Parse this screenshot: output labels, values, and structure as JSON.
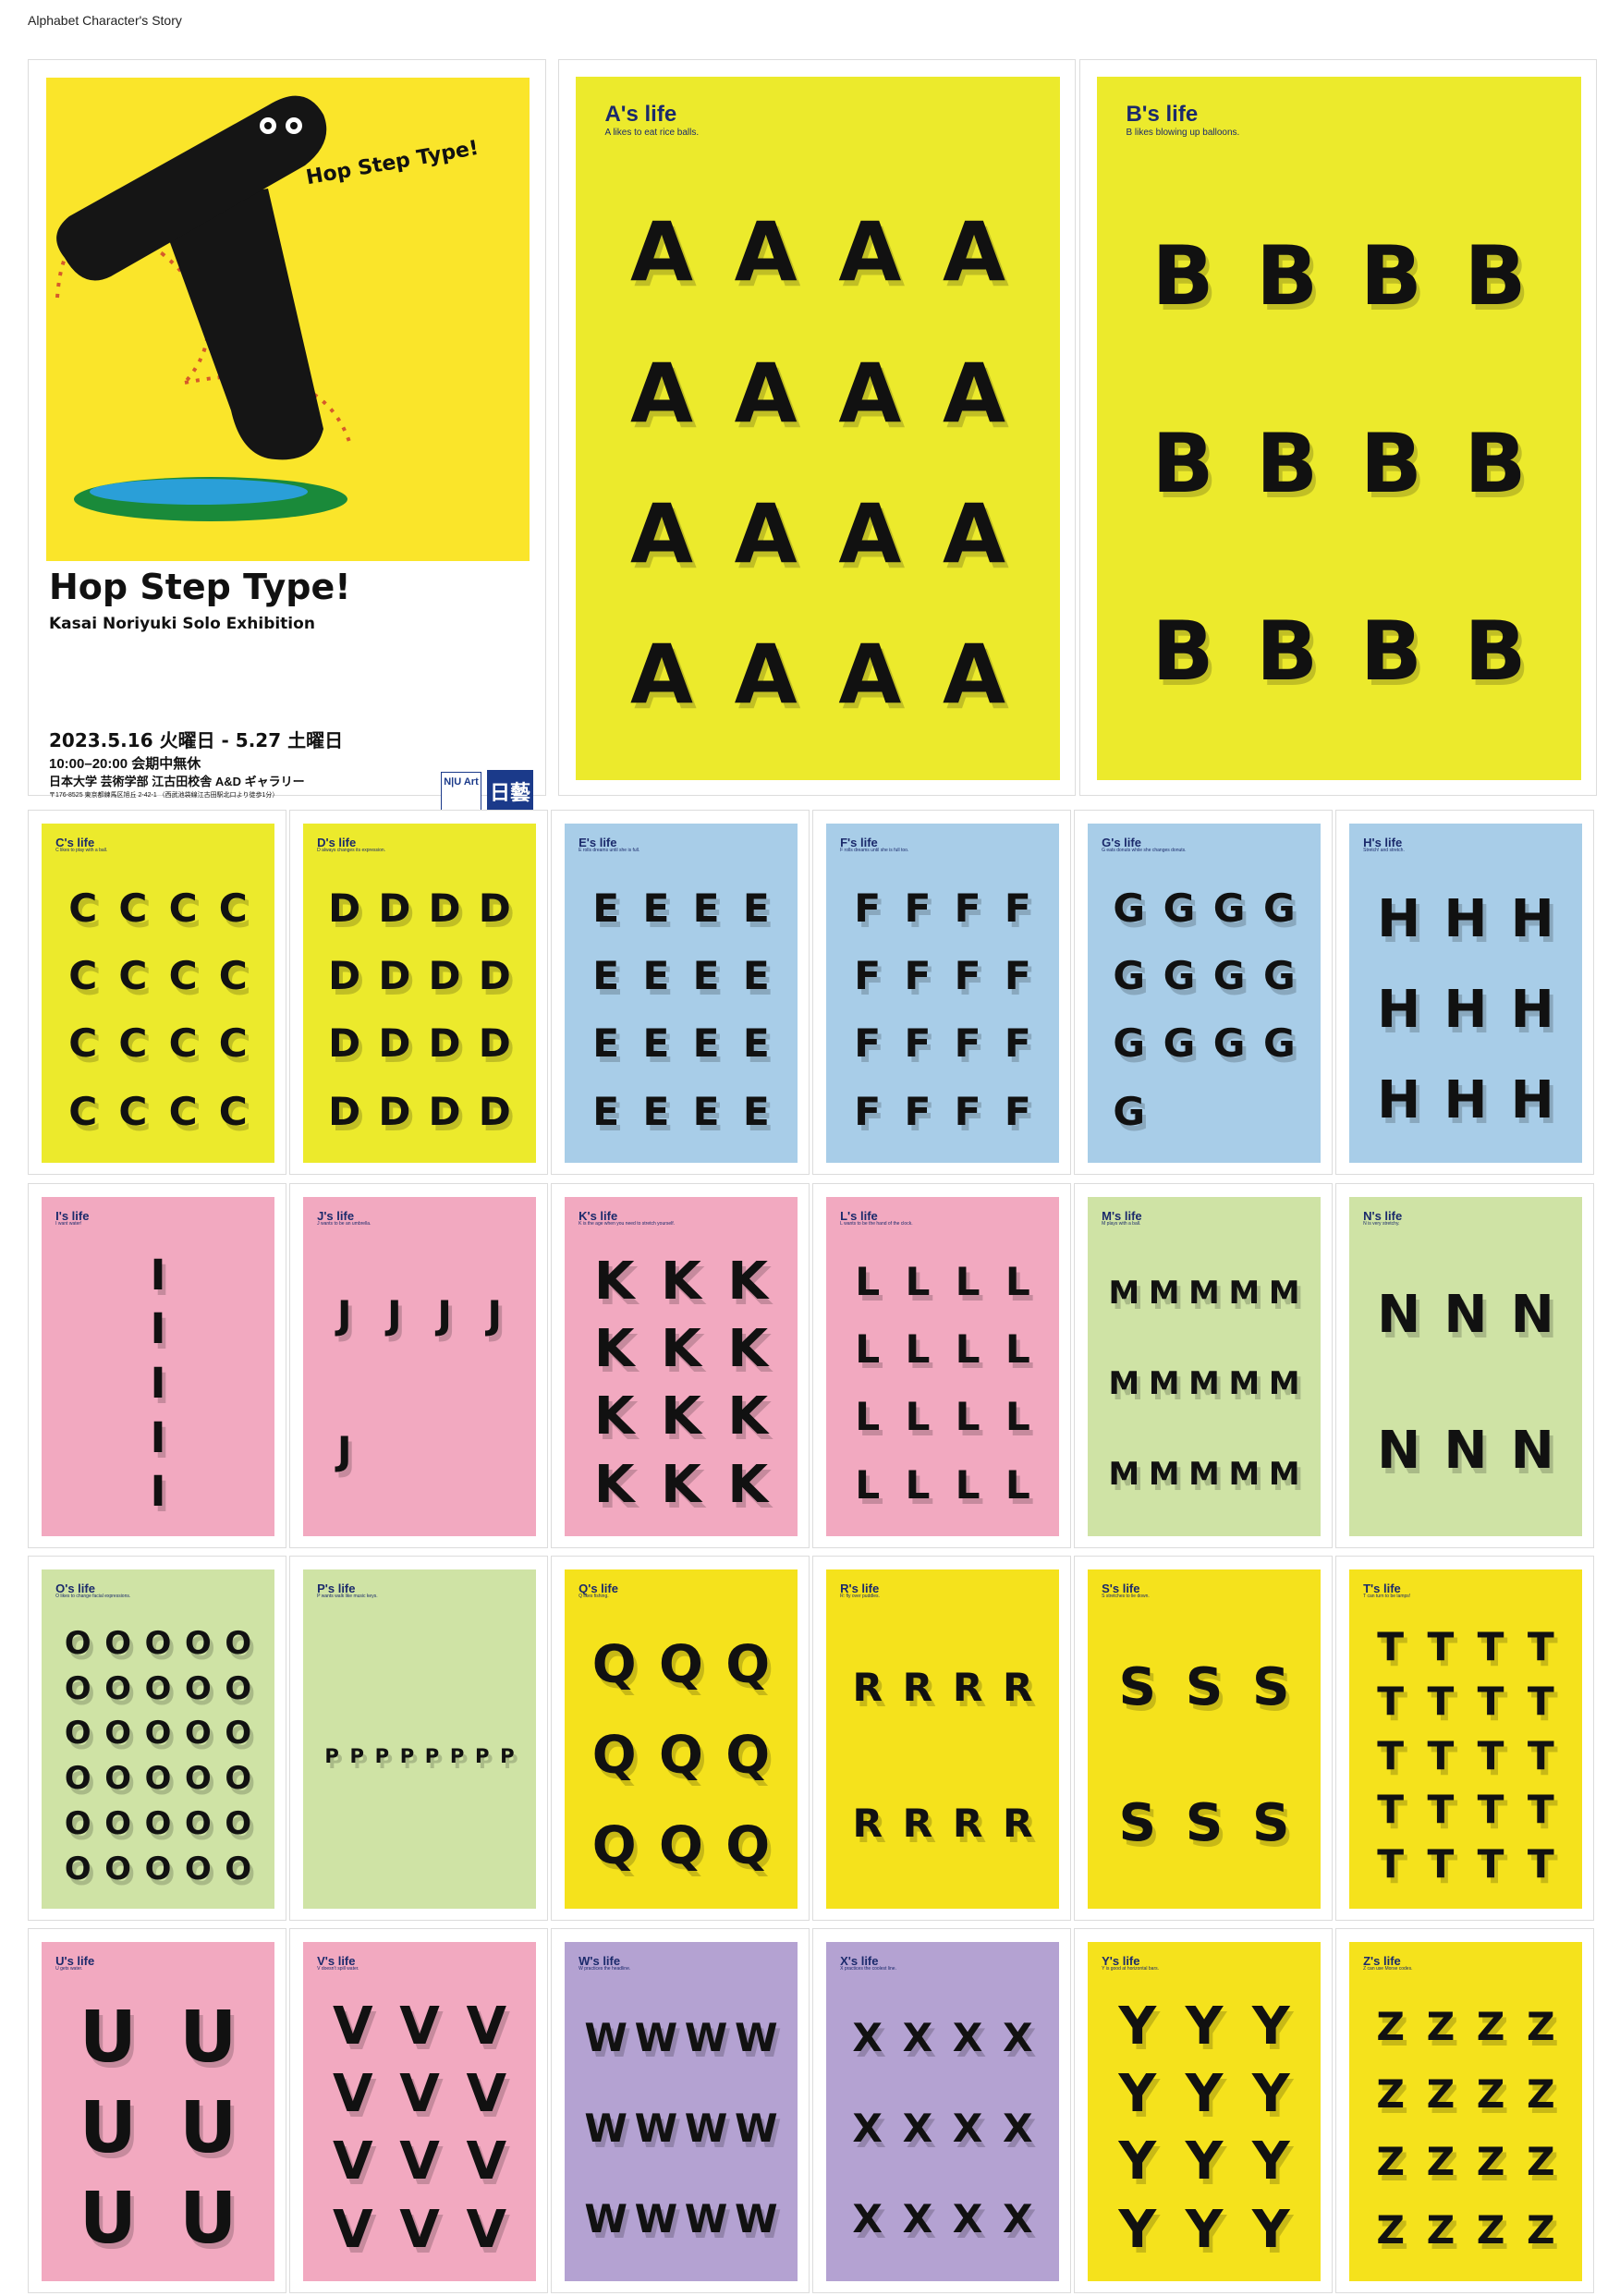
{
  "page_title": "Alphabet Character's Story",
  "main_poster": {
    "tagline": "Hop Step Type!",
    "headline": "Hop Step Type!",
    "subtitle": "Kasai Noriyuki Solo Exhibition",
    "dates": "2023.5.16 火曜日 - 5.27 土曜日",
    "hours": "10:00–20:00 会期中無休",
    "venue": "日本大学 芸術学部 江古田校舎 A&D ギャラリー",
    "address": "〒176-8525 東京都練馬区旭丘 2-42-1 （西武池袋線江古田駅北口より徒歩1分）",
    "logo_text": "N|U Art",
    "seal_text": "日藝"
  },
  "posters": [
    {
      "title": "A's life",
      "subtitle": "A likes to eat rice balls.",
      "letter": "A",
      "bg": "#ecea2c",
      "cols": 4,
      "count": 16
    },
    {
      "title": "B's life",
      "subtitle": "B likes blowing up balloons.",
      "letter": "B",
      "bg": "#ecea2c",
      "cols": 4,
      "count": 12
    },
    {
      "title": "C's life",
      "subtitle": "C likes to play with a ball.",
      "letter": "C",
      "bg": "#ecea2c",
      "cols": 4,
      "count": 16
    },
    {
      "title": "D's life",
      "subtitle": "D always changes its expression.",
      "letter": "D",
      "bg": "#ecea2c",
      "cols": 4,
      "count": 16
    },
    {
      "title": "E's life",
      "subtitle": "E rolls dreams until she is full.",
      "letter": "E",
      "bg": "#a8cde8",
      "cols": 4,
      "count": 16
    },
    {
      "title": "F's life",
      "subtitle": "F rolls dreams until she is full too.",
      "letter": "F",
      "bg": "#a8cde8",
      "cols": 4,
      "count": 16
    },
    {
      "title": "G's life",
      "subtitle": "G eats donuts while she changes donuts.",
      "letter": "G",
      "bg": "#a8cde8",
      "cols": 4,
      "count": 13
    },
    {
      "title": "H's life",
      "subtitle": "Stretch! and stretch.",
      "letter": "H",
      "bg": "#a8cde8",
      "cols": 3,
      "count": 9
    },
    {
      "title": "I's life",
      "subtitle": "I want water!",
      "letter": "I",
      "bg": "#f2a9c0",
      "cols": 1,
      "count": 5
    },
    {
      "title": "J's life",
      "subtitle": "J wants to be an umbrella.",
      "letter": "J",
      "bg": "#f2a9c0",
      "cols": 4,
      "count": 5
    },
    {
      "title": "K's life",
      "subtitle": "K is the age when you need to stretch yourself.",
      "letter": "K",
      "bg": "#f2a9c0",
      "cols": 3,
      "count": 12
    },
    {
      "title": "L's life",
      "subtitle": "L wants to be the hand of the clock.",
      "letter": "L",
      "bg": "#f2a9c0",
      "cols": 4,
      "count": 16
    },
    {
      "title": "M's life",
      "subtitle": "M plays with a ball.",
      "letter": "M",
      "bg": "#cfe3a5",
      "cols": 5,
      "count": 15
    },
    {
      "title": "N's life",
      "subtitle": "N is very stretchy.",
      "letter": "N",
      "bg": "#cfe3a5",
      "cols": 3,
      "count": 6
    },
    {
      "title": "O's life",
      "subtitle": "O likes to change facial expressions.",
      "letter": "O",
      "bg": "#cfe3a5",
      "cols": 5,
      "count": 30
    },
    {
      "title": "P's life",
      "subtitle": "P wants walk like music keys.",
      "letter": "P",
      "bg": "#cfe3a5",
      "cols": 8,
      "count": 8
    },
    {
      "title": "Q's life",
      "subtitle": "Q likes fishing.",
      "letter": "Q",
      "bg": "#f5e21c",
      "cols": 3,
      "count": 9
    },
    {
      "title": "R's life",
      "subtitle": "R: fly over puddles.",
      "letter": "R",
      "bg": "#f5e21c",
      "cols": 4,
      "count": 8
    },
    {
      "title": "S's life",
      "subtitle": "S stretches to lie down.",
      "letter": "S",
      "bg": "#f5e21c",
      "cols": 3,
      "count": 6
    },
    {
      "title": "T's life",
      "subtitle": "T can turn to be lamps!",
      "letter": "T",
      "bg": "#f5e21c",
      "cols": 4,
      "count": 20
    },
    {
      "title": "U's life",
      "subtitle": "U gets water.",
      "letter": "U",
      "bg": "#f2a9c0",
      "cols": 2,
      "count": 6
    },
    {
      "title": "V's life",
      "subtitle": "V doesn't spill water.",
      "letter": "V",
      "bg": "#f2a9c0",
      "cols": 3,
      "count": 12
    },
    {
      "title": "W's life",
      "subtitle": "W practices the headline.",
      "letter": "W",
      "bg": "#b4a2d2",
      "cols": 4,
      "count": 12
    },
    {
      "title": "X's life",
      "subtitle": "X practices the coolest line.",
      "letter": "X",
      "bg": "#b4a2d2",
      "cols": 4,
      "count": 12
    },
    {
      "title": "Y's life",
      "subtitle": "Y is good at horizontal bars.",
      "letter": "Y",
      "bg": "#f5e21c",
      "cols": 3,
      "count": 12
    },
    {
      "title": "Z's life",
      "subtitle": "Z can use Morse codes.",
      "letter": "Z",
      "bg": "#f5e21c",
      "cols": 4,
      "count": 16
    }
  ]
}
